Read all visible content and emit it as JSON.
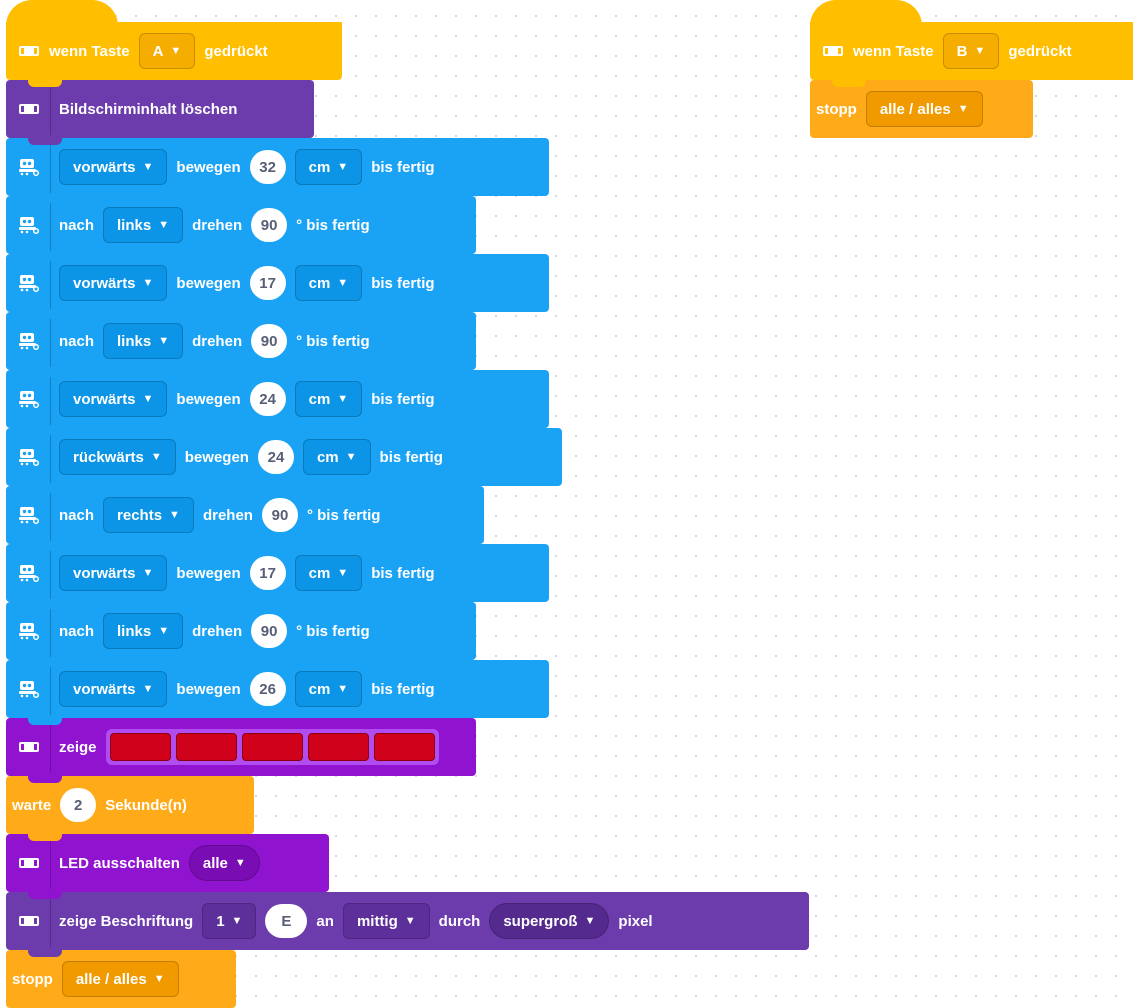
{
  "script_a": {
    "event": {
      "prefix": "wenn Taste",
      "key": "A",
      "suffix": "gedrückt"
    },
    "clear": {
      "label": "Bildschirminhalt löschen"
    },
    "motion": [
      {
        "type": "move",
        "direction": "vorwärts",
        "verb": "bewegen",
        "value": "32",
        "unit": "cm",
        "tail": "bis fertig"
      },
      {
        "type": "turn",
        "prefix": "nach",
        "direction": "links",
        "verb": "drehen",
        "value": "90",
        "tail": "° bis fertig"
      },
      {
        "type": "move",
        "direction": "vorwärts",
        "verb": "bewegen",
        "value": "17",
        "unit": "cm",
        "tail": "bis fertig"
      },
      {
        "type": "turn",
        "prefix": "nach",
        "direction": "links",
        "verb": "drehen",
        "value": "90",
        "tail": "° bis fertig"
      },
      {
        "type": "move",
        "direction": "vorwärts",
        "verb": "bewegen",
        "value": "24",
        "unit": "cm",
        "tail": "bis fertig"
      },
      {
        "type": "move",
        "direction": "rückwärts",
        "verb": "bewegen",
        "value": "24",
        "unit": "cm",
        "tail": "bis fertig"
      },
      {
        "type": "turn",
        "prefix": "nach",
        "direction": "rechts",
        "verb": "drehen",
        "value": "90",
        "tail": "° bis fertig"
      },
      {
        "type": "move",
        "direction": "vorwärts",
        "verb": "bewegen",
        "value": "17",
        "unit": "cm",
        "tail": "bis fertig"
      },
      {
        "type": "turn",
        "prefix": "nach",
        "direction": "links",
        "verb": "drehen",
        "value": "90",
        "tail": "° bis fertig"
      },
      {
        "type": "move",
        "direction": "vorwärts",
        "verb": "bewegen",
        "value": "26",
        "unit": "cm",
        "tail": "bis fertig"
      }
    ],
    "show_leds": {
      "label": "zeige",
      "led_color": "#d0021b",
      "led_count": 5
    },
    "wait": {
      "prefix": "warte",
      "value": "2",
      "suffix": "Sekunde(n)"
    },
    "led_off": {
      "label": "LED ausschalten",
      "option": "alle"
    },
    "show_text": {
      "label": "zeige Beschriftung",
      "slot": "1",
      "text": "E",
      "at": "an",
      "position": "mittig",
      "by": "durch",
      "size": "supergroß",
      "unit": "pixel"
    },
    "stop": {
      "label": "stopp",
      "option": "alle / alles"
    }
  },
  "script_b": {
    "event": {
      "prefix": "wenn Taste",
      "key": "B",
      "suffix": "gedrückt"
    },
    "stop": {
      "label": "stopp",
      "option": "alle / alles"
    }
  },
  "colors": {
    "event": "#ffbf00",
    "control": "#ffab19",
    "display": "#6c3bac",
    "display_alt": "#9013d0",
    "motion": "#1aa3f5",
    "led_red": "#d0021b"
  },
  "icons": {
    "dropdown": "▼",
    "hub": "hub-icon",
    "robot": "robot-icon"
  }
}
